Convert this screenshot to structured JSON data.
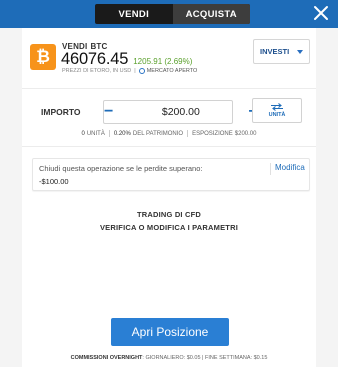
{
  "toggle": {
    "sell": "VENDI",
    "buy": "ACQUISTA"
  },
  "instrument": {
    "action": "VENDI",
    "symbol": "BTC",
    "logo_glyph": "₿",
    "price": "46076.45",
    "change": "1205.91 (2.69%)",
    "meta_prices": "PREZZI DI ETORO, IN USD",
    "market_status": "MERCATO APERTO",
    "logo_color": "#f7931a",
    "change_color": "#5aa02c"
  },
  "invest": {
    "label": "INVESTI"
  },
  "amount": {
    "label": "IMPORTO",
    "value": "$200.00",
    "minus": "−",
    "plus": "+",
    "unit_label": "UNITÀ"
  },
  "summary": {
    "units_value": "0",
    "units_label": "UNITÀ",
    "equity_value": "0.20%",
    "equity_label": "DEL PATRIMONIO",
    "exposure_label": "ESPOSIZIONE",
    "exposure_value": "$200.00"
  },
  "stop_loss": {
    "text": "Chiudi questa operazione se le perdite superano:",
    "value": "-$100.00",
    "edit": "Modifica"
  },
  "cfd": {
    "line1": "TRADING DI CFD",
    "line2": "VERIFICA O MODIFICA I PARAMETRI"
  },
  "open_button": {
    "label": "Apri Posizione"
  },
  "overnight": {
    "label": "COMMISSIONI OVERNIGHT",
    "daily_label": "GIORNALIERO",
    "daily_value": "$0.05",
    "weekend_label": "FINE SETTIMANA",
    "weekend_value": "$0.15"
  },
  "colors": {
    "topbar": "#1e6cb8",
    "accent": "#2a7fd4",
    "toggle_bg": "#1a1a1a"
  },
  "icons": [
    "close-icon",
    "bitcoin-logo-icon",
    "clock-icon",
    "caret-down-icon",
    "swap-arrows-icon",
    "minus-icon",
    "plus-icon"
  ]
}
